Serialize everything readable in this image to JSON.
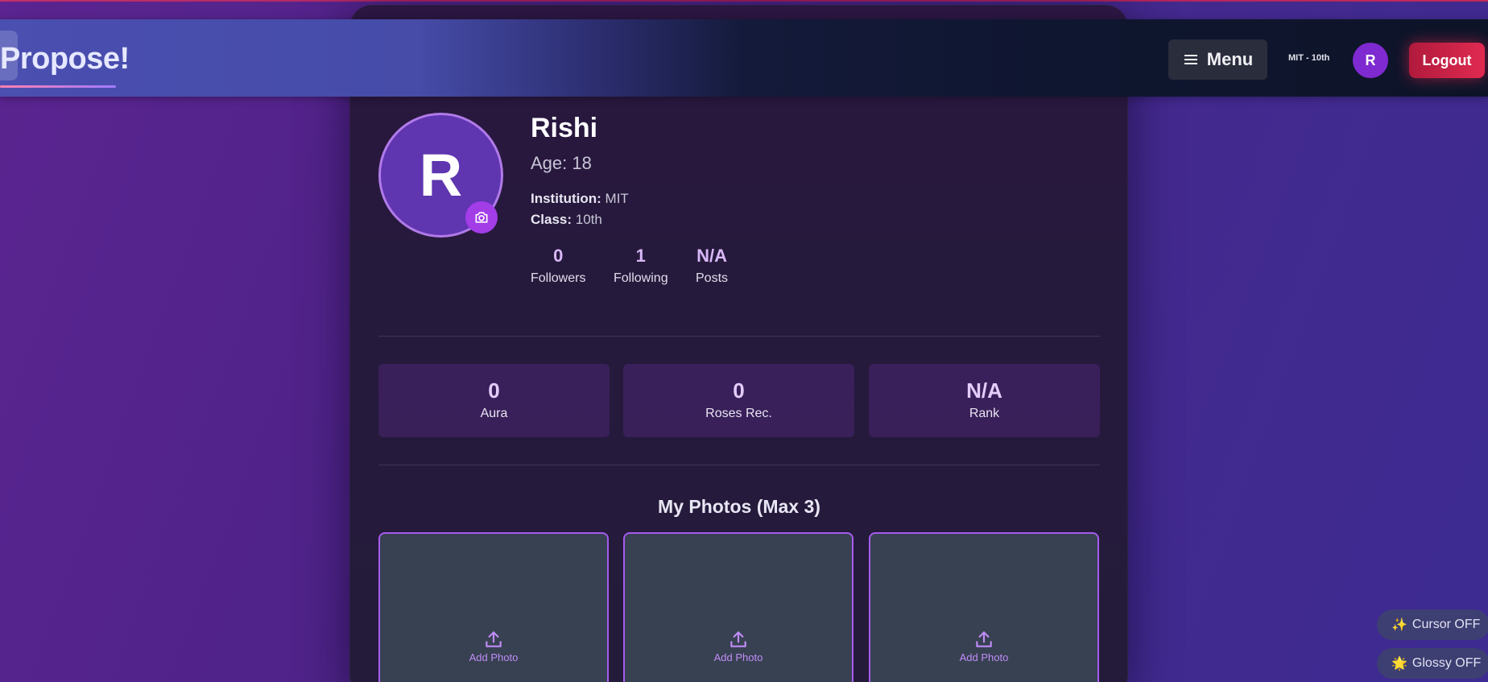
{
  "header": {
    "brand": "Propose!",
    "menu_label": "Menu",
    "school_class": "MIT - 10th",
    "avatar_initial": "R",
    "logout_label": "Logout"
  },
  "profile": {
    "avatar_initial": "R",
    "name": "Rishi",
    "age_label": "Age:",
    "age_value": "18",
    "institution_label": "Institution:",
    "institution_value": "MIT",
    "class_label": "Class:",
    "class_value": "10th",
    "stats": [
      {
        "value": "0",
        "label": "Followers"
      },
      {
        "value": "1",
        "label": "Following"
      },
      {
        "value": "N/A",
        "label": "Posts"
      }
    ]
  },
  "metrics": [
    {
      "value": "0",
      "label": "Aura"
    },
    {
      "value": "0",
      "label": "Roses Rec."
    },
    {
      "value": "N/A",
      "label": "Rank"
    }
  ],
  "photos": {
    "title": "My Photos (Max 3)",
    "slots": [
      {
        "label": "Add Photo"
      },
      {
        "label": "Add Photo"
      },
      {
        "label": "Add Photo"
      }
    ]
  },
  "toggles": {
    "cursor": {
      "icon": "✨",
      "label": "Cursor OFF"
    },
    "glossy": {
      "icon": "🌟",
      "label": "Glossy OFF"
    }
  },
  "colors": {
    "accent": "#a23de8",
    "logout": "#e02a50",
    "photo_border": "#a65cf0"
  }
}
